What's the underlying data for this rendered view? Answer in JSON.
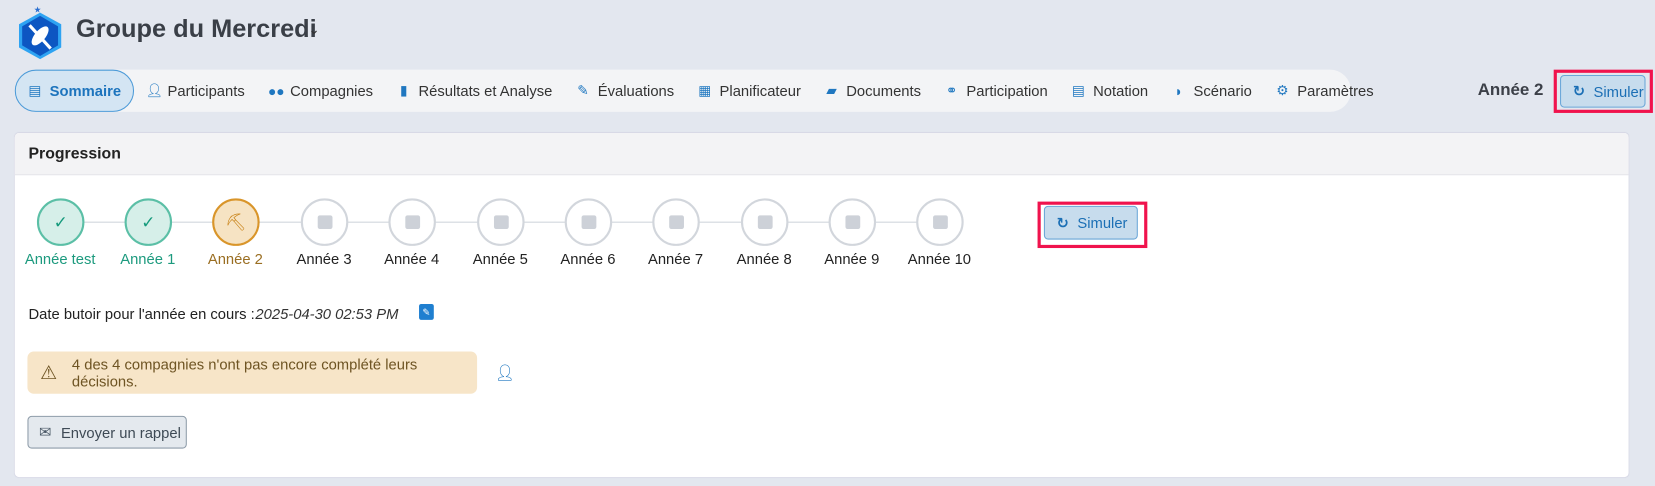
{
  "header": {
    "title": "Groupe du Mercredi",
    "dropdown_icon": "chevron-down-icon",
    "current_year": "Année 2",
    "simulate_label": "Simuler"
  },
  "nav": {
    "items": [
      {
        "label": "Sommaire",
        "icon": "list-icon",
        "active": true
      },
      {
        "label": "Participants",
        "icon": "user-icon"
      },
      {
        "label": "Compagnies",
        "icon": "users-icon"
      },
      {
        "label": "Résultats et Analyse",
        "icon": "bar-chart-icon"
      },
      {
        "label": "Évaluations",
        "icon": "file-edit-icon"
      },
      {
        "label": "Planificateur",
        "icon": "calendar-icon"
      },
      {
        "label": "Documents",
        "icon": "folder-open-icon"
      },
      {
        "label": "Participation",
        "icon": "handshake-icon"
      },
      {
        "label": "Notation",
        "icon": "grading-icon"
      },
      {
        "label": "Scénario",
        "icon": "book-reader-icon"
      },
      {
        "label": "Paramètres",
        "icon": "gear-icon"
      }
    ]
  },
  "progression": {
    "title": "Progression",
    "steps": [
      {
        "label": "Année test",
        "status": "done"
      },
      {
        "label": "Année 1",
        "status": "done"
      },
      {
        "label": "Année 2",
        "status": "current"
      },
      {
        "label": "Année 3",
        "status": "todo"
      },
      {
        "label": "Année 4",
        "status": "todo"
      },
      {
        "label": "Année 5",
        "status": "todo"
      },
      {
        "label": "Année 6",
        "status": "todo"
      },
      {
        "label": "Année 7",
        "status": "todo"
      },
      {
        "label": "Année 8",
        "status": "todo"
      },
      {
        "label": "Année 9",
        "status": "todo"
      },
      {
        "label": "Année 10",
        "status": "todo"
      }
    ],
    "simulate_label": "Simuler",
    "deadline_label": "Date butoir pour l'année en cours :",
    "deadline_value": "2025-04-30 02:53 PM",
    "alert_text": "4 des 4 compagnies n'ont pas encore complété leurs décisions.",
    "reminder_label": "Envoyer un rappel"
  },
  "colors": {
    "accent": "#1f77c0",
    "highlight": "#f0134d",
    "done": "#5bbfa6",
    "current": "#d9952a"
  }
}
